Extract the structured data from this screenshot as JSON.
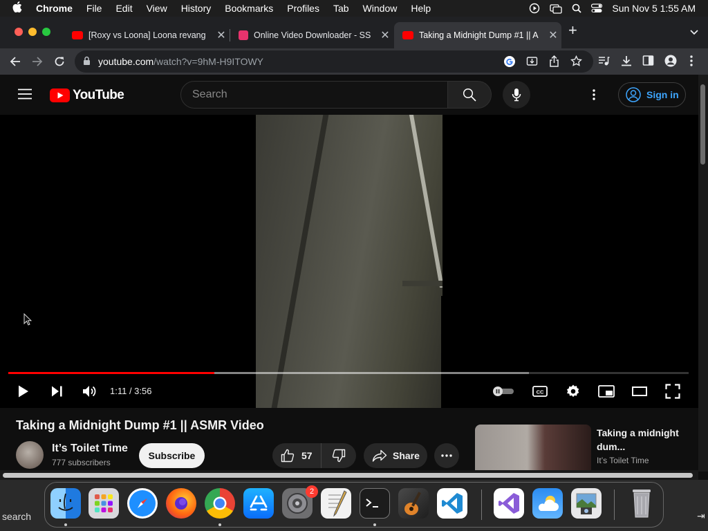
{
  "menubar": {
    "app": "Chrome",
    "items": [
      "File",
      "Edit",
      "View",
      "History",
      "Bookmarks",
      "Profiles",
      "Tab",
      "Window",
      "Help"
    ],
    "clock": "Sun Nov 5  1:55 AM"
  },
  "tabs": [
    {
      "title": "[Roxy vs Loona] Loona revang",
      "favicon_color": "#ff0000",
      "active": false
    },
    {
      "title": "Online Video Downloader - SS",
      "favicon_color": "#e8336d",
      "active": false
    },
    {
      "title": "Taking a Midnight Dump #1 || A",
      "favicon_color": "#ff0000",
      "active": true
    }
  ],
  "omnibox": {
    "url_host": "youtube.com",
    "url_path": "/watch?v=9hM-H9ITOWY"
  },
  "youtube": {
    "logo_text": "YouTube",
    "search_placeholder": "Search",
    "signin_label": "Sign in"
  },
  "player": {
    "current_time": "1:11",
    "duration": "3:56",
    "time_display": "1:11 / 3:56",
    "played_fraction": 0.303,
    "loaded_fraction": 0.765
  },
  "video": {
    "title": "Taking a Midnight Dump #1 || ASMR Video",
    "channel": "It’s Toilet Time",
    "subscribers": "777 subscribers",
    "subscribe_label": "Subscribe",
    "likes": "57",
    "share_label": "Share"
  },
  "recommendation": {
    "title": "Taking a midnight dum...",
    "channel": "It’s Toilet Time"
  },
  "desktop": {
    "search_text": "search",
    "arrow_glyph": "⇥"
  },
  "dock": {
    "apps": [
      "Finder",
      "Launchpad",
      "Safari",
      "Firefox",
      "Chrome",
      "App Store",
      "System Settings",
      "TextEdit",
      "Terminal",
      "GarageBand",
      "Visual Studio Code",
      "Visual Studio",
      "Weather",
      "Preview",
      "Trash"
    ],
    "settings_badge": "2"
  },
  "colors": {
    "accent_red": "#ff0000",
    "link_blue": "#3ea6ff",
    "background": "#0f0f0f"
  }
}
